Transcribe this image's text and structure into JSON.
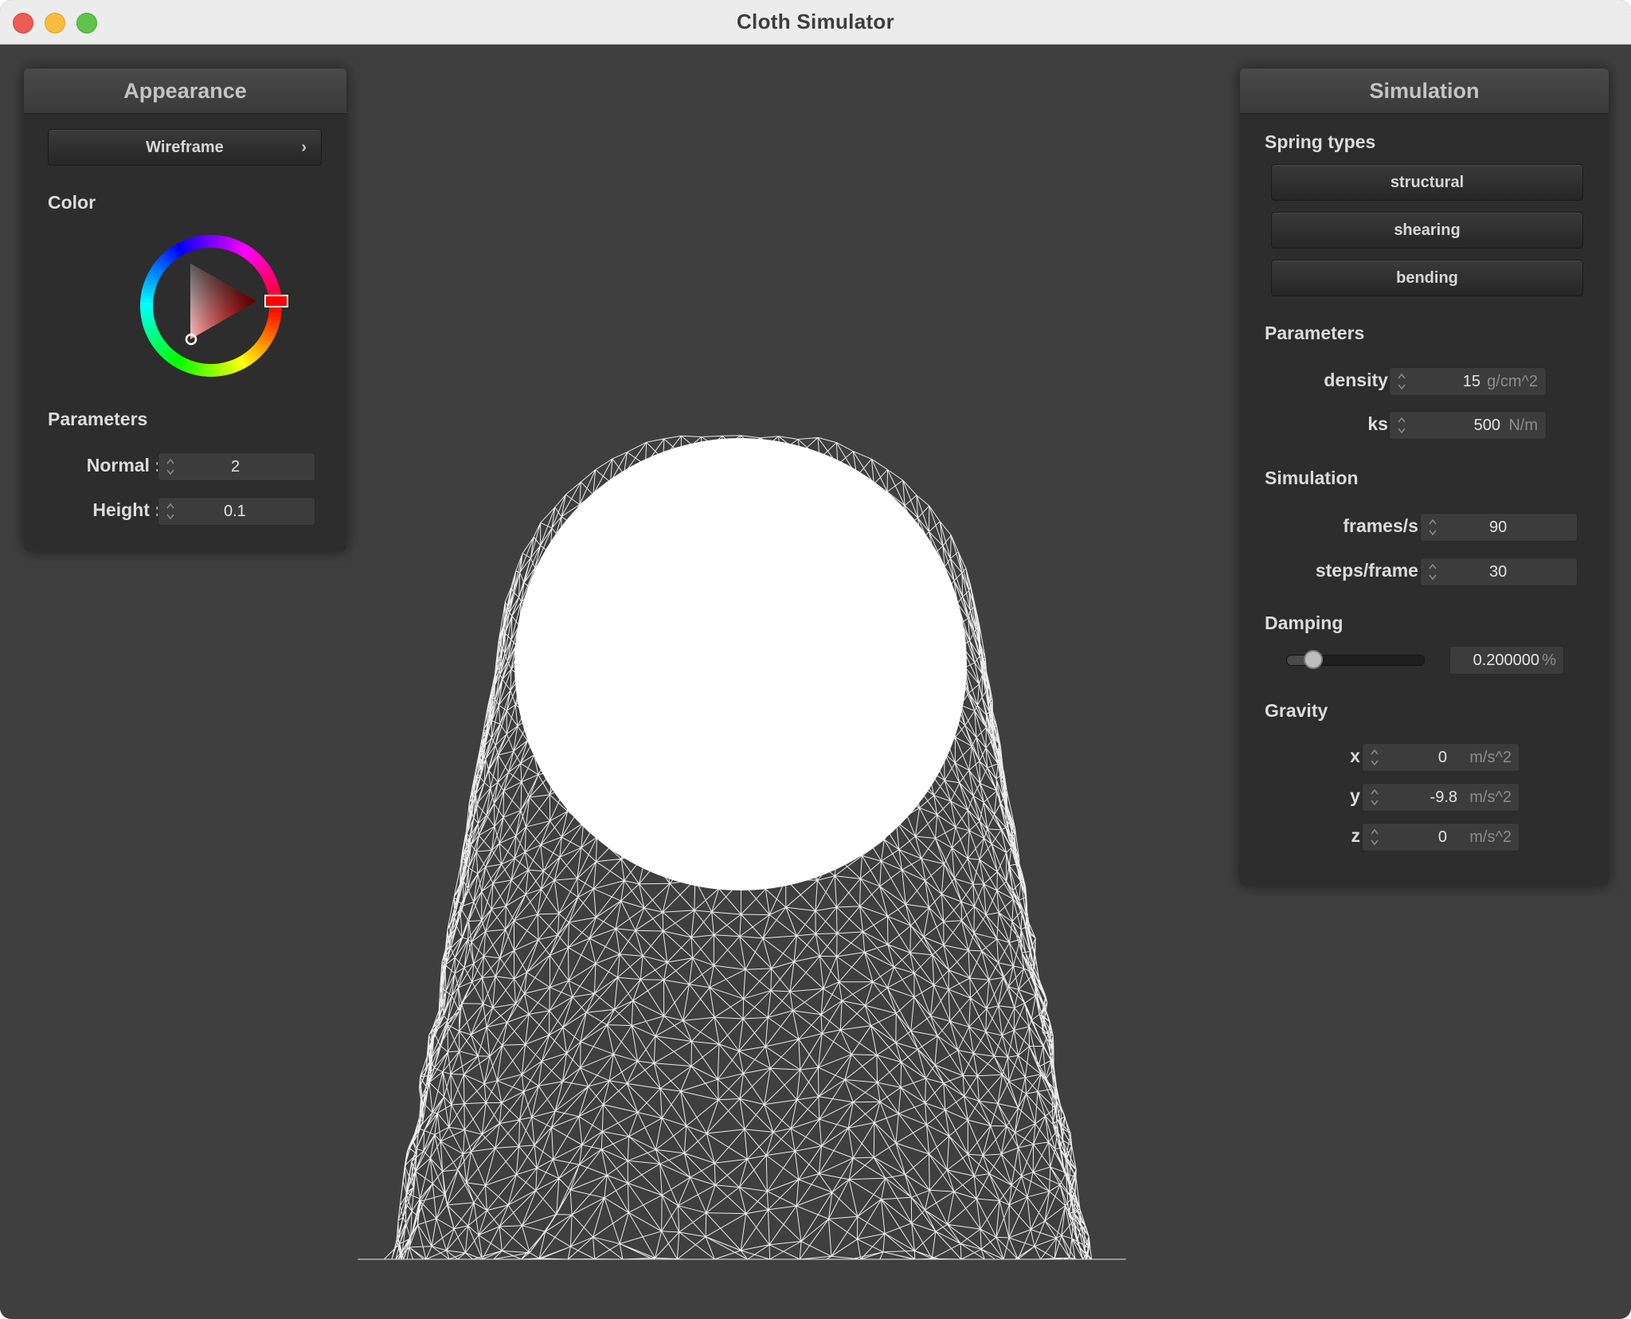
{
  "window": {
    "title": "Cloth Simulator"
  },
  "appearance": {
    "title": "Appearance",
    "shader_button": "Wireframe",
    "color_label": "Color",
    "parameters_label": "Parameters",
    "normal_label": "Normal :",
    "normal_value": "2",
    "height_label": "Height :",
    "height_value": "0.1",
    "selected_color": "#ff0000"
  },
  "simulation": {
    "title": "Simulation",
    "spring_types_label": "Spring types",
    "spring_buttons": [
      "structural",
      "shearing",
      "bending"
    ],
    "parameters_label": "Parameters",
    "density_label": "density :",
    "density_value": "15",
    "density_unit": "g/cm^2",
    "ks_label": "ks :",
    "ks_value": "500",
    "ks_unit": "N/m",
    "simulation_label": "Simulation",
    "fps_label": "frames/s :",
    "fps_value": "90",
    "steps_label": "steps/frame :",
    "steps_value": "30",
    "damping_label": "Damping",
    "damping_value": "0.200000",
    "damping_unit": "%",
    "damping_slider_fraction": 0.2,
    "gravity_label": "Gravity",
    "gx_label": "x :",
    "gx_value": "0",
    "gy_label": "y :",
    "gy_value": "-9.8",
    "gz_label": "z :",
    "gz_value": "0",
    "g_unit": "m/s^2"
  },
  "scene": {
    "render_mode": "wireframe",
    "object": "sphere",
    "mesh_color": "#ffffff",
    "background": "#3f3f3f"
  }
}
